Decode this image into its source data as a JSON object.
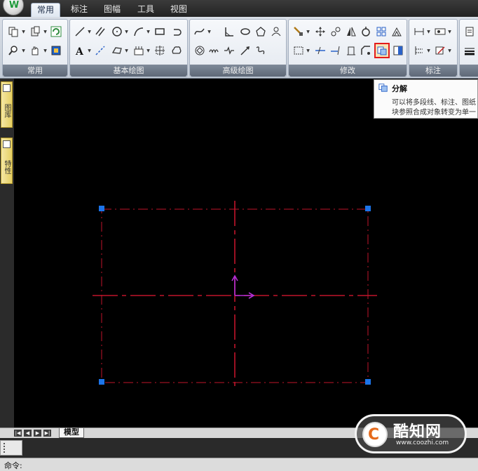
{
  "tabs": [
    {
      "label": "常用",
      "active": true
    },
    {
      "label": "标注",
      "active": false
    },
    {
      "label": "图幅",
      "active": false
    },
    {
      "label": "工具",
      "active": false
    },
    {
      "label": "视图",
      "active": false
    }
  ],
  "ribbon": {
    "panels": [
      {
        "id": "common",
        "title": "常用"
      },
      {
        "id": "basic-draw",
        "title": "基本绘图"
      },
      {
        "id": "advanced-draw",
        "title": "高级绘图"
      },
      {
        "id": "modify",
        "title": "修改"
      },
      {
        "id": "annotate",
        "title": "标注"
      }
    ]
  },
  "palette": {
    "tab1": "图库",
    "tab2": "特性"
  },
  "tooltip": {
    "title": "分解",
    "line1": "可以将多段线、标注、图纸",
    "line2": "块参照合成对象转变为单一"
  },
  "layout": {
    "model_tab": "模型"
  },
  "command": {
    "label": "命令:"
  },
  "watermark": {
    "logo_char": "C",
    "name": "酷知网",
    "url": "www.coozhi.com"
  },
  "colors": {
    "canvas_bg": "#000000",
    "drawing_red": "#c0142a",
    "axis_magenta": "#b42fd6",
    "grip_blue": "#1c74e8",
    "highlight_red": "#e31b1b"
  }
}
